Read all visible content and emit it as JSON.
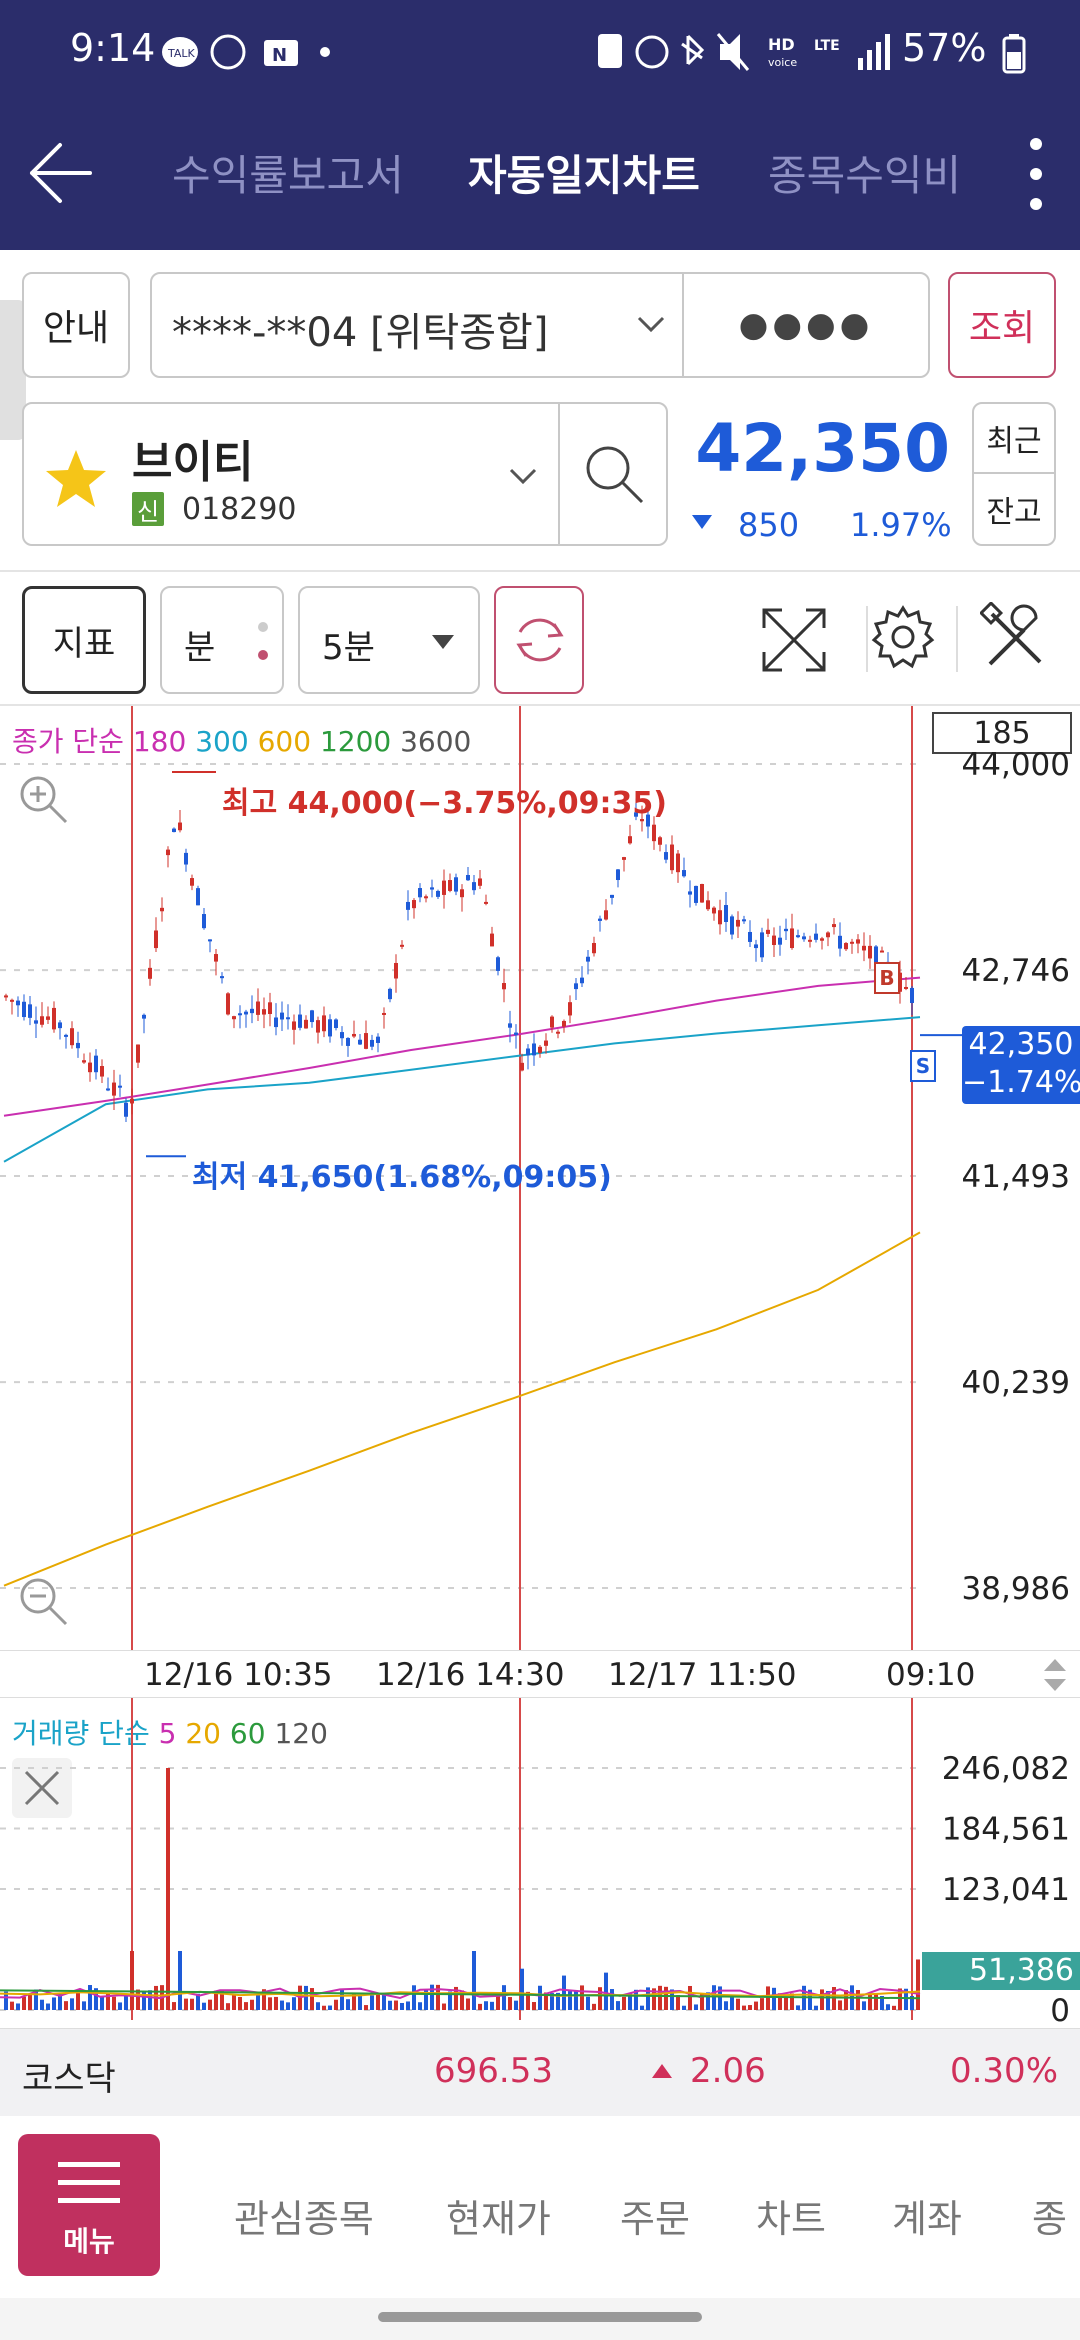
{
  "status": {
    "time": "9:14",
    "battery": "57%",
    "hd_label": "HD",
    "voice_label": "voice",
    "lte_label": "LTE"
  },
  "header": {
    "tabs": [
      "수익률보고서",
      "자동일지차트",
      "종목수익비"
    ],
    "active_tab": "자동일지차트"
  },
  "account": {
    "guide_button": "안내",
    "account_text": "****-**04 [위탁종합]",
    "password_mask": "●●●●",
    "query_button": "조회"
  },
  "stock": {
    "name": "브이티",
    "badge": "신",
    "code": "018290",
    "price": "42,350",
    "change": "850",
    "change_pct": "1.97%",
    "recent_button": "최근",
    "balance_button": "잔고"
  },
  "toolbar": {
    "indicator_button": "지표",
    "minute_button": "분",
    "interval_select": "5분"
  },
  "price_chart": {
    "legend": {
      "label": "종가 단순",
      "periods": [
        "180",
        "300",
        "600",
        "1200",
        "3600"
      ],
      "colors": [
        "#c92fb0",
        "#1aa3c8",
        "#e6a800",
        "#2b9a3c",
        "#555555"
      ]
    },
    "count_box": "185",
    "y_ticks": [
      "44,000",
      "42,746",
      "41,493",
      "40,239",
      "38,986"
    ],
    "x_ticks": [
      "12/16 10:35",
      "12/16 14:30",
      "12/17 11:50",
      "09:10"
    ],
    "high_label": "최고 44,000(−3.75%,09:35)",
    "low_label": "최저 41,650(1.68%,09:05)",
    "current_price": "42,350",
    "current_pct": "−1.74%",
    "buy_marker": "B",
    "sell_marker": "S"
  },
  "volume_chart": {
    "legend": {
      "label": "거래량 단순",
      "periods": [
        "5",
        "20",
        "60",
        "120"
      ],
      "colors": [
        "#c92fb0",
        "#e6a800",
        "#2b9a3c",
        "#555555"
      ]
    },
    "y_ticks": [
      "246,082",
      "184,561",
      "123,041",
      "0"
    ],
    "current_volume": "51,386"
  },
  "chart_data": [
    {
      "type": "candlestick",
      "title": "",
      "xlabel": "",
      "ylabel": "",
      "ylim": [
        38986,
        44000
      ],
      "x_ticks": [
        "12/16 10:35",
        "12/16 14:30",
        "12/17 11:50",
        "09:10"
      ],
      "series": [
        {
          "name": "180",
          "values": [
            41860,
            41950,
            42050,
            42150,
            42260,
            42350,
            42450,
            42560,
            42650,
            42700
          ]
        },
        {
          "name": "300",
          "values": [
            41580,
            41930,
            42020,
            42060,
            42140,
            42220,
            42300,
            42360,
            42410,
            42460
          ]
        },
        {
          "name": "600",
          "values": [
            39000,
            39250,
            39480,
            39700,
            39930,
            40140,
            40360,
            40560,
            40800,
            41150
          ]
        }
      ],
      "annotations": {
        "high": 44000,
        "low": 41650,
        "last": 42350
      }
    },
    {
      "type": "bar",
      "title": "",
      "ylim": [
        0,
        246082
      ],
      "y_ticks": [
        0,
        123041,
        184561,
        246082
      ],
      "last": 51386
    }
  ],
  "market": {
    "name": "코스닥",
    "value": "696.53",
    "change": "2.06",
    "change_pct": "0.30%"
  },
  "bottom_nav": {
    "menu_label": "메뉴",
    "items": [
      "관심종목",
      "현재가",
      "주문",
      "차트",
      "계좌",
      "종"
    ]
  }
}
